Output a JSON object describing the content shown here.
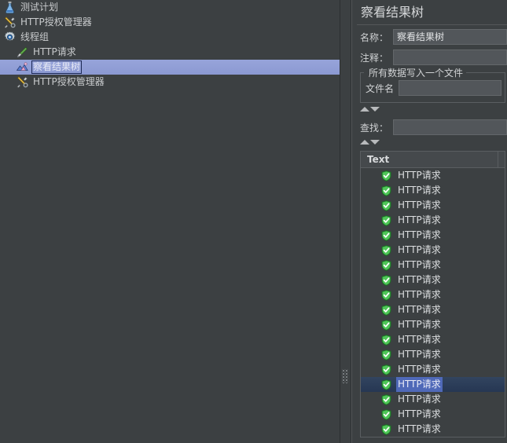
{
  "window": {
    "background_color": "#3c4042",
    "accent_selection_tree": "#8f9fd8",
    "accent_selection_list": "#4f69b8",
    "text_color": "#c8cacc"
  },
  "tree": {
    "items": [
      {
        "label": "测试计划",
        "icon": "flask-icon",
        "indent": 1,
        "selected": false
      },
      {
        "label": "HTTP授权管理器",
        "icon": "wrench-icon",
        "indent": 1,
        "selected": false
      },
      {
        "label": "线程组",
        "icon": "gear-icon",
        "indent": 1,
        "selected": false
      },
      {
        "label": "HTTP请求",
        "icon": "probe-icon",
        "indent": 2,
        "selected": false
      },
      {
        "label": "察看结果树",
        "icon": "tree-icon",
        "indent": 2,
        "selected": true
      },
      {
        "label": "HTTP授权管理器",
        "icon": "wrench-icon",
        "indent": 2,
        "selected": false
      }
    ]
  },
  "splitter": {
    "grip_icon": "splitter-grip-icon"
  },
  "panel": {
    "title": "察看结果树",
    "name_label": "名称：",
    "name_value": "察看结果树",
    "comment_label": "注释：",
    "comment_value": "",
    "comment_placeholder": "",
    "groupbox_legend": "所有数据写入一个文件",
    "filename_label": "文件名",
    "filename_value": "",
    "filename_placeholder": "",
    "search_label": "查找：",
    "search_value": "",
    "search_placeholder": "",
    "collapse_up_icon": "triangle-up-icon",
    "collapse_down_icon": "triangle-down-icon"
  },
  "results": {
    "columns": [
      "Text"
    ],
    "row_icon": "green-shield-check-icon",
    "selected_index": 14,
    "rows": [
      {
        "text": "HTTP请求"
      },
      {
        "text": "HTTP请求"
      },
      {
        "text": "HTTP请求"
      },
      {
        "text": "HTTP请求"
      },
      {
        "text": "HTTP请求"
      },
      {
        "text": "HTTP请求"
      },
      {
        "text": "HTTP请求"
      },
      {
        "text": "HTTP请求"
      },
      {
        "text": "HTTP请求"
      },
      {
        "text": "HTTP请求"
      },
      {
        "text": "HTTP请求"
      },
      {
        "text": "HTTP请求"
      },
      {
        "text": "HTTP请求"
      },
      {
        "text": "HTTP请求"
      },
      {
        "text": "HTTP请求"
      },
      {
        "text": "HTTP请求"
      },
      {
        "text": "HTTP请求"
      },
      {
        "text": "HTTP请求"
      }
    ]
  }
}
